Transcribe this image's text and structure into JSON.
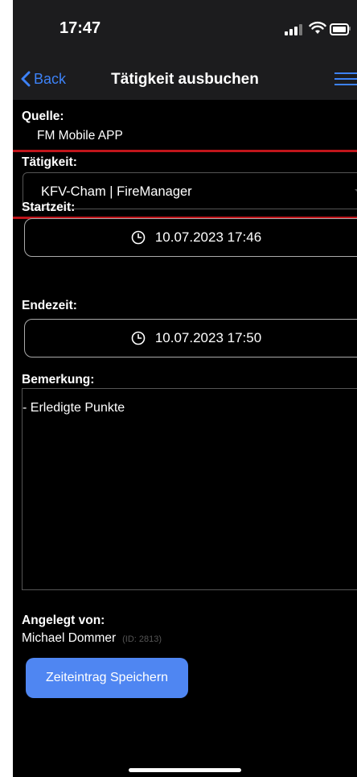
{
  "status_bar": {
    "time": "17:47"
  },
  "nav": {
    "back_label": "Back",
    "title": "Tätigkeit ausbuchen"
  },
  "form": {
    "source_label": "Quelle:",
    "source_value": "FM Mobile APP",
    "activity_label": "Tätigkeit:",
    "activity_value": "KFV-Cham | FireManager",
    "start_label": "Startzeit:",
    "start_value": "10.07.2023 17:46",
    "end_label": "Endezeit:",
    "end_value": "10.07.2023 17:50",
    "remark_label": "Bemerkung:",
    "remark_value": "- Erledigte Punkte",
    "created_by_label": "Angelegt von:",
    "created_by_name": "Michael Dommer",
    "created_by_id": "(ID: 2813)",
    "save_label": "Zeiteintrag Speichern"
  },
  "colors": {
    "accent": "#3d82f7",
    "save_button": "#4f86f2",
    "highlight_border": "#c0151b",
    "background": "#000000",
    "bar_background": "#1c1c1e"
  },
  "icons": [
    "chevron-left-icon",
    "hamburger-menu-icon",
    "clock-icon",
    "signal-icon",
    "wifi-icon",
    "battery-icon",
    "dropdown-caret-icon"
  ]
}
